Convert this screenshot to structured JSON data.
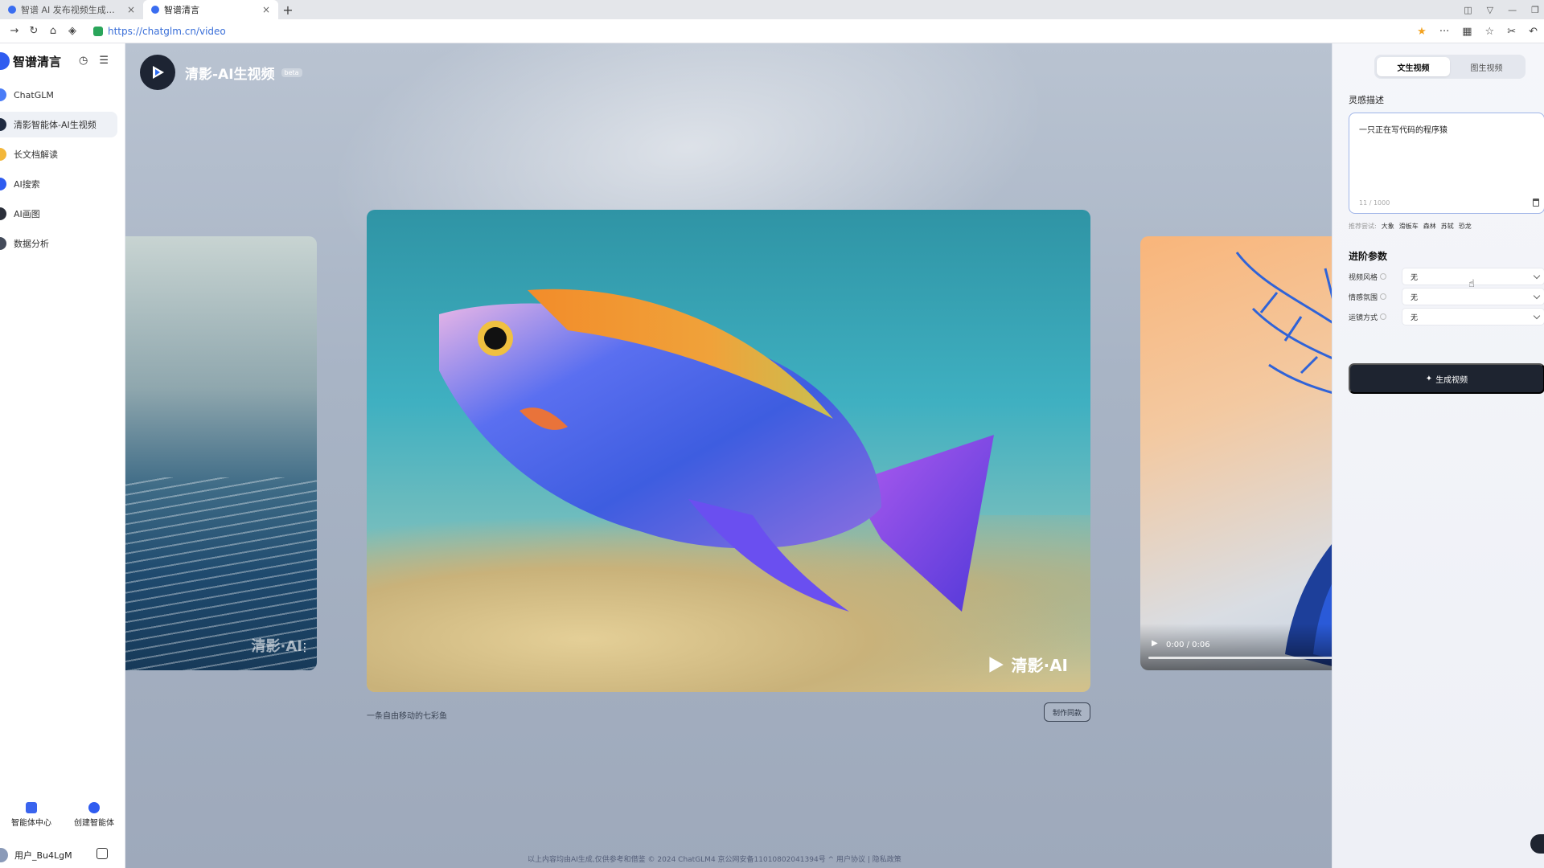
{
  "browser": {
    "tabs": [
      {
        "title": "智谱 AI 发布视频生成工具\"清影\"",
        "close": "×"
      },
      {
        "title": "智谱清言",
        "close": "×"
      }
    ],
    "new_tab": "+",
    "url": "https://chatglm.cn/video"
  },
  "sidebar": {
    "brand": "智谱清言",
    "items": [
      {
        "label": "ChatGLM",
        "color": "#4a7cf7"
      },
      {
        "label": "清影智能体-AI生视频",
        "color": "#1f2a40"
      },
      {
        "label": "长文档解读",
        "color": "#f3b73a"
      },
      {
        "label": "AI搜索",
        "color": "#2f5cf0"
      },
      {
        "label": "AI画图",
        "color": "#2b2f3a"
      },
      {
        "label": "数据分析",
        "color": "#444b5a"
      }
    ],
    "bottom": {
      "agent_center": "智能体中心",
      "create_agent": "创建智能体"
    },
    "user": "用户_Bu4LgM"
  },
  "main": {
    "title": "清影-AI生视频",
    "badge": "beta",
    "watermark": "清影·AI",
    "left_watermark": "清影·AI",
    "right_video_time": "0:00 / 0:06",
    "caption": "一条自由移动的七彩鱼",
    "make_same": "制作同款",
    "footer": "以上内容均由AI生成,仅供参考和借鉴   © 2024 ChatGLM4 京公网安备11010802041394号 ^   用户协议  |  隐私政策"
  },
  "panel": {
    "tabs": [
      "文生视频",
      "图生视频"
    ],
    "inspiration_label": "灵感描述",
    "prompt": "一只正在写代码的程序猿",
    "count": "11 / 1000",
    "suggest_label": "推荐尝试:",
    "suggestions": [
      "大象",
      "滑板车",
      "森林",
      "苏轼",
      "恐龙"
    ],
    "advanced": "进阶参数",
    "params": [
      {
        "label": "视频风格",
        "value": "无"
      },
      {
        "label": "情感氛围",
        "value": "无"
      },
      {
        "label": "运镜方式",
        "value": "无"
      }
    ],
    "generate": "生成视频"
  }
}
